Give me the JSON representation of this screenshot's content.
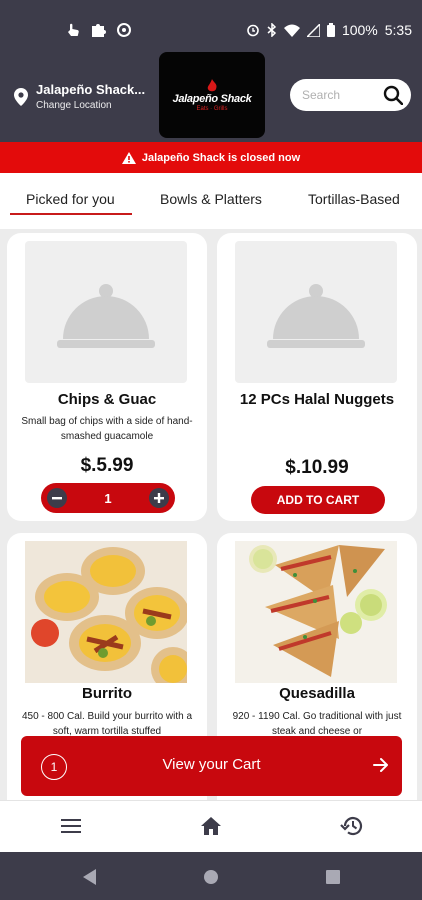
{
  "status_bar": {
    "battery": "100%",
    "time": "5:35"
  },
  "header": {
    "location_name": "Jalapeño Shack...",
    "location_action": "Change Location",
    "logo_text": "Jalapeño Shack",
    "logo_subtext": "Eats · Grills",
    "search_placeholder": "Search"
  },
  "banner": {
    "text": "Jalapeño Shack is closed now"
  },
  "tabs": [
    {
      "label": "Picked for you",
      "active": true
    },
    {
      "label": "Bowls & Platters",
      "active": false
    },
    {
      "label": "Tortillas-Based",
      "active": false
    }
  ],
  "items": [
    {
      "title": "Chips & Guac",
      "description": "Small bag of chips with a side of hand-smashed guacamole",
      "price": "$.5.99",
      "quantity": "1"
    },
    {
      "title": "12 PCs Halal Nuggets",
      "description": "",
      "price": "$.10.99",
      "action": "ADD TO CART"
    },
    {
      "title": "Burrito",
      "description": "450 - 800 Cal. Build your burrito with a soft, warm tortilla stuffed"
    },
    {
      "title": "Quesadilla",
      "description": "920 - 1190 Cal. Go traditional with just steak and cheese or"
    }
  ],
  "cart": {
    "count": "1",
    "label": "View your Cart"
  },
  "colors": {
    "brand_red": "#c8080e",
    "header_dark": "#3d3c4a",
    "banner_red": "#e30b0b"
  }
}
